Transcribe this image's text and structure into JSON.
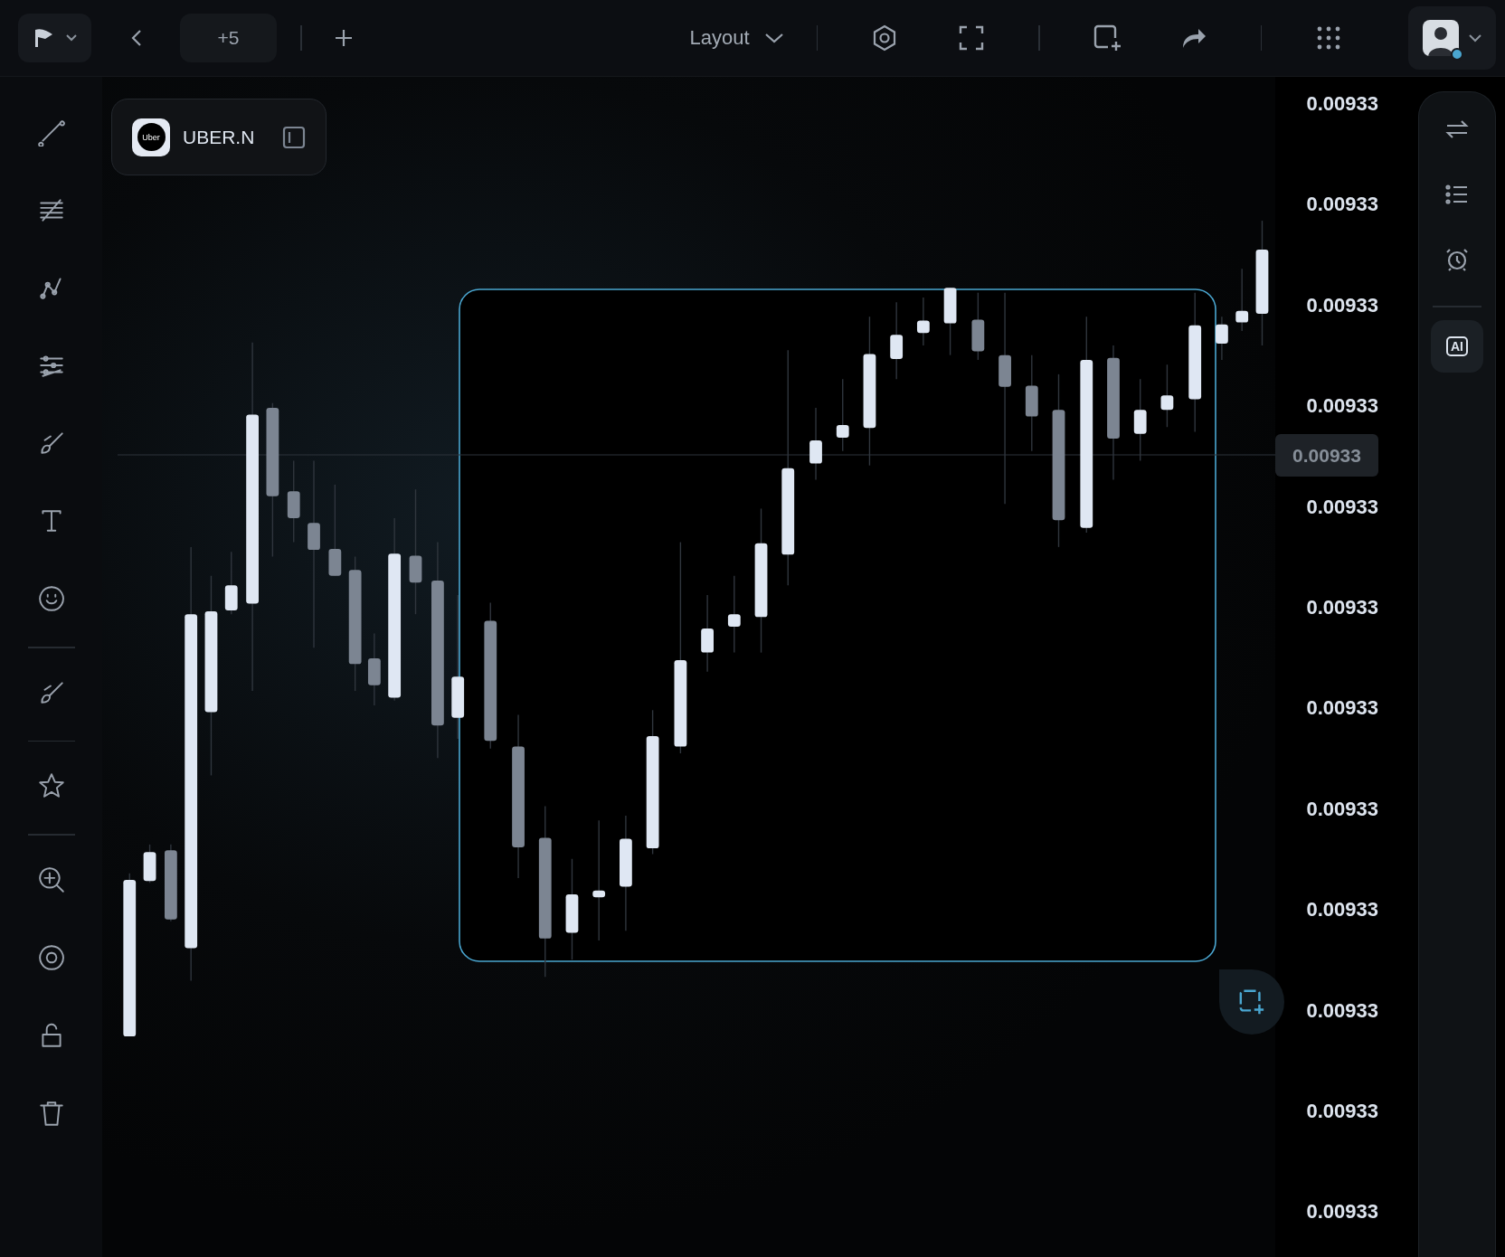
{
  "top_bar": {
    "tab_count": "+5",
    "layout_label": "Layout",
    "user": {
      "online": true
    }
  },
  "symbol": {
    "logo_text": "Uber",
    "name": "UBER.N"
  },
  "price_axis": {
    "labels": [
      "0.00933",
      "0.00933",
      "0.00933",
      "0.00933",
      "0.00933",
      "0.00933",
      "0.00933",
      "0.00933",
      "0.00933",
      "0.00933",
      "0.00933",
      "0.00933"
    ],
    "crosshair_price": "0.00933"
  },
  "right_panel": {
    "items": [
      {
        "kind": "swap",
        "selected": false
      },
      {
        "kind": "list",
        "selected": false
      },
      {
        "kind": "alarm",
        "selected": false
      },
      {
        "kind": "ai",
        "label": "AI",
        "selected": true
      }
    ]
  }
}
